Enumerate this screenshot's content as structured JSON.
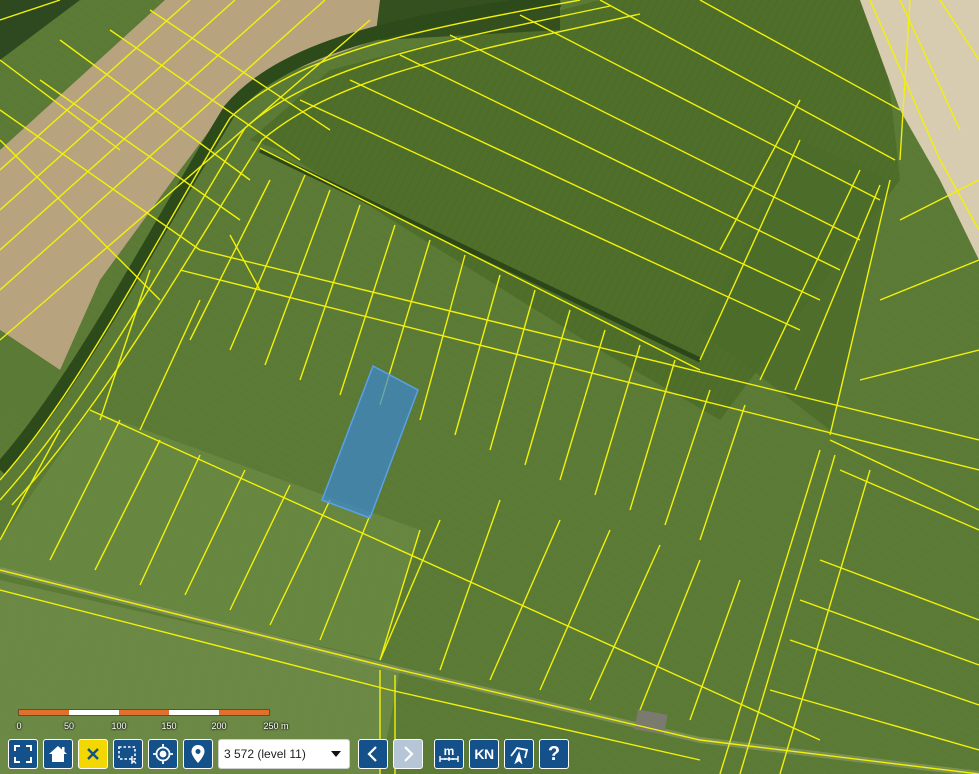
{
  "scale_bar": {
    "labels": [
      "0",
      "50",
      "100",
      "150",
      "200",
      "250 m"
    ],
    "segment_colors": [
      "#e0702e",
      "#ffffff",
      "#e0702e",
      "#ffffff",
      "#e0702e"
    ]
  },
  "toolbar": {
    "scale_select_value": "3 572 (level 11)",
    "kn_label": "KN",
    "help_label": "?"
  },
  "map": {
    "parcel_line_color": "#f1f10a",
    "selected_parcel_color": "#3b87d4"
  }
}
